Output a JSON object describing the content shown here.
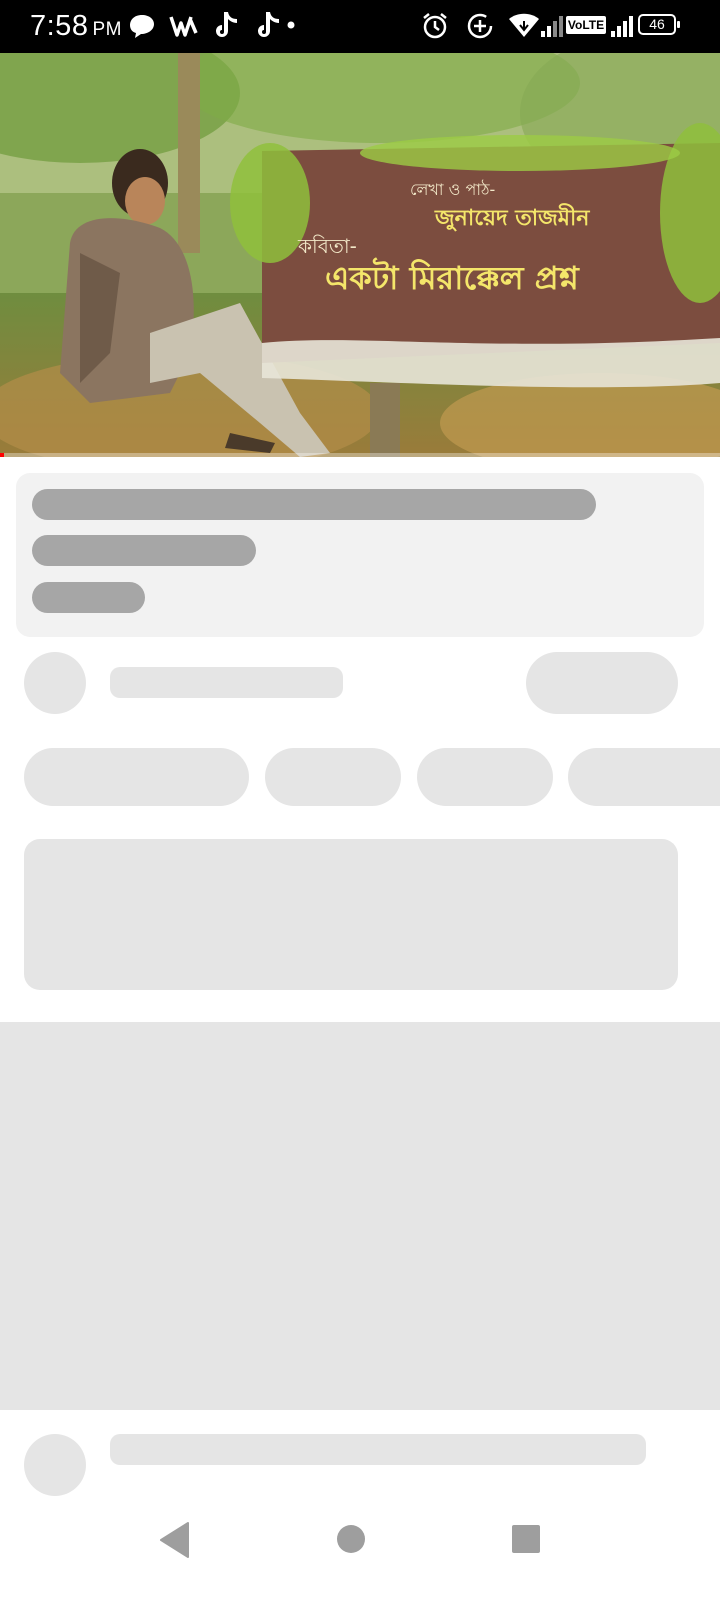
{
  "status_bar": {
    "time": "7:58",
    "ampm": "PM",
    "network_badge": "VoLTE",
    "battery_level": "46",
    "icons": [
      "chat-bubble-icon",
      "stylus-app-icon",
      "tiktok-icon",
      "tiktok-icon",
      "more-dot-icon",
      "alarm-icon",
      "data-saver-icon",
      "wifi-icon",
      "signal-icon",
      "signal-icon",
      "battery-icon"
    ]
  },
  "video": {
    "banner_line1": "লেখা ও পাঠ-",
    "banner_line2": "জুনায়েদ তাজমীন",
    "banner_label": "কবিতা-",
    "banner_title": "একটা মিরাক্কেল প্রশ্ন",
    "progress_fraction": 0.005,
    "progress_color": "#ff0000"
  },
  "skeleton": {
    "dark_color": "#a6a6a6",
    "light_color": "#e5e5e5",
    "card_color": "#f2f2f2"
  },
  "nav": {
    "icons": [
      "back-icon",
      "home-icon",
      "recents-icon"
    ]
  }
}
